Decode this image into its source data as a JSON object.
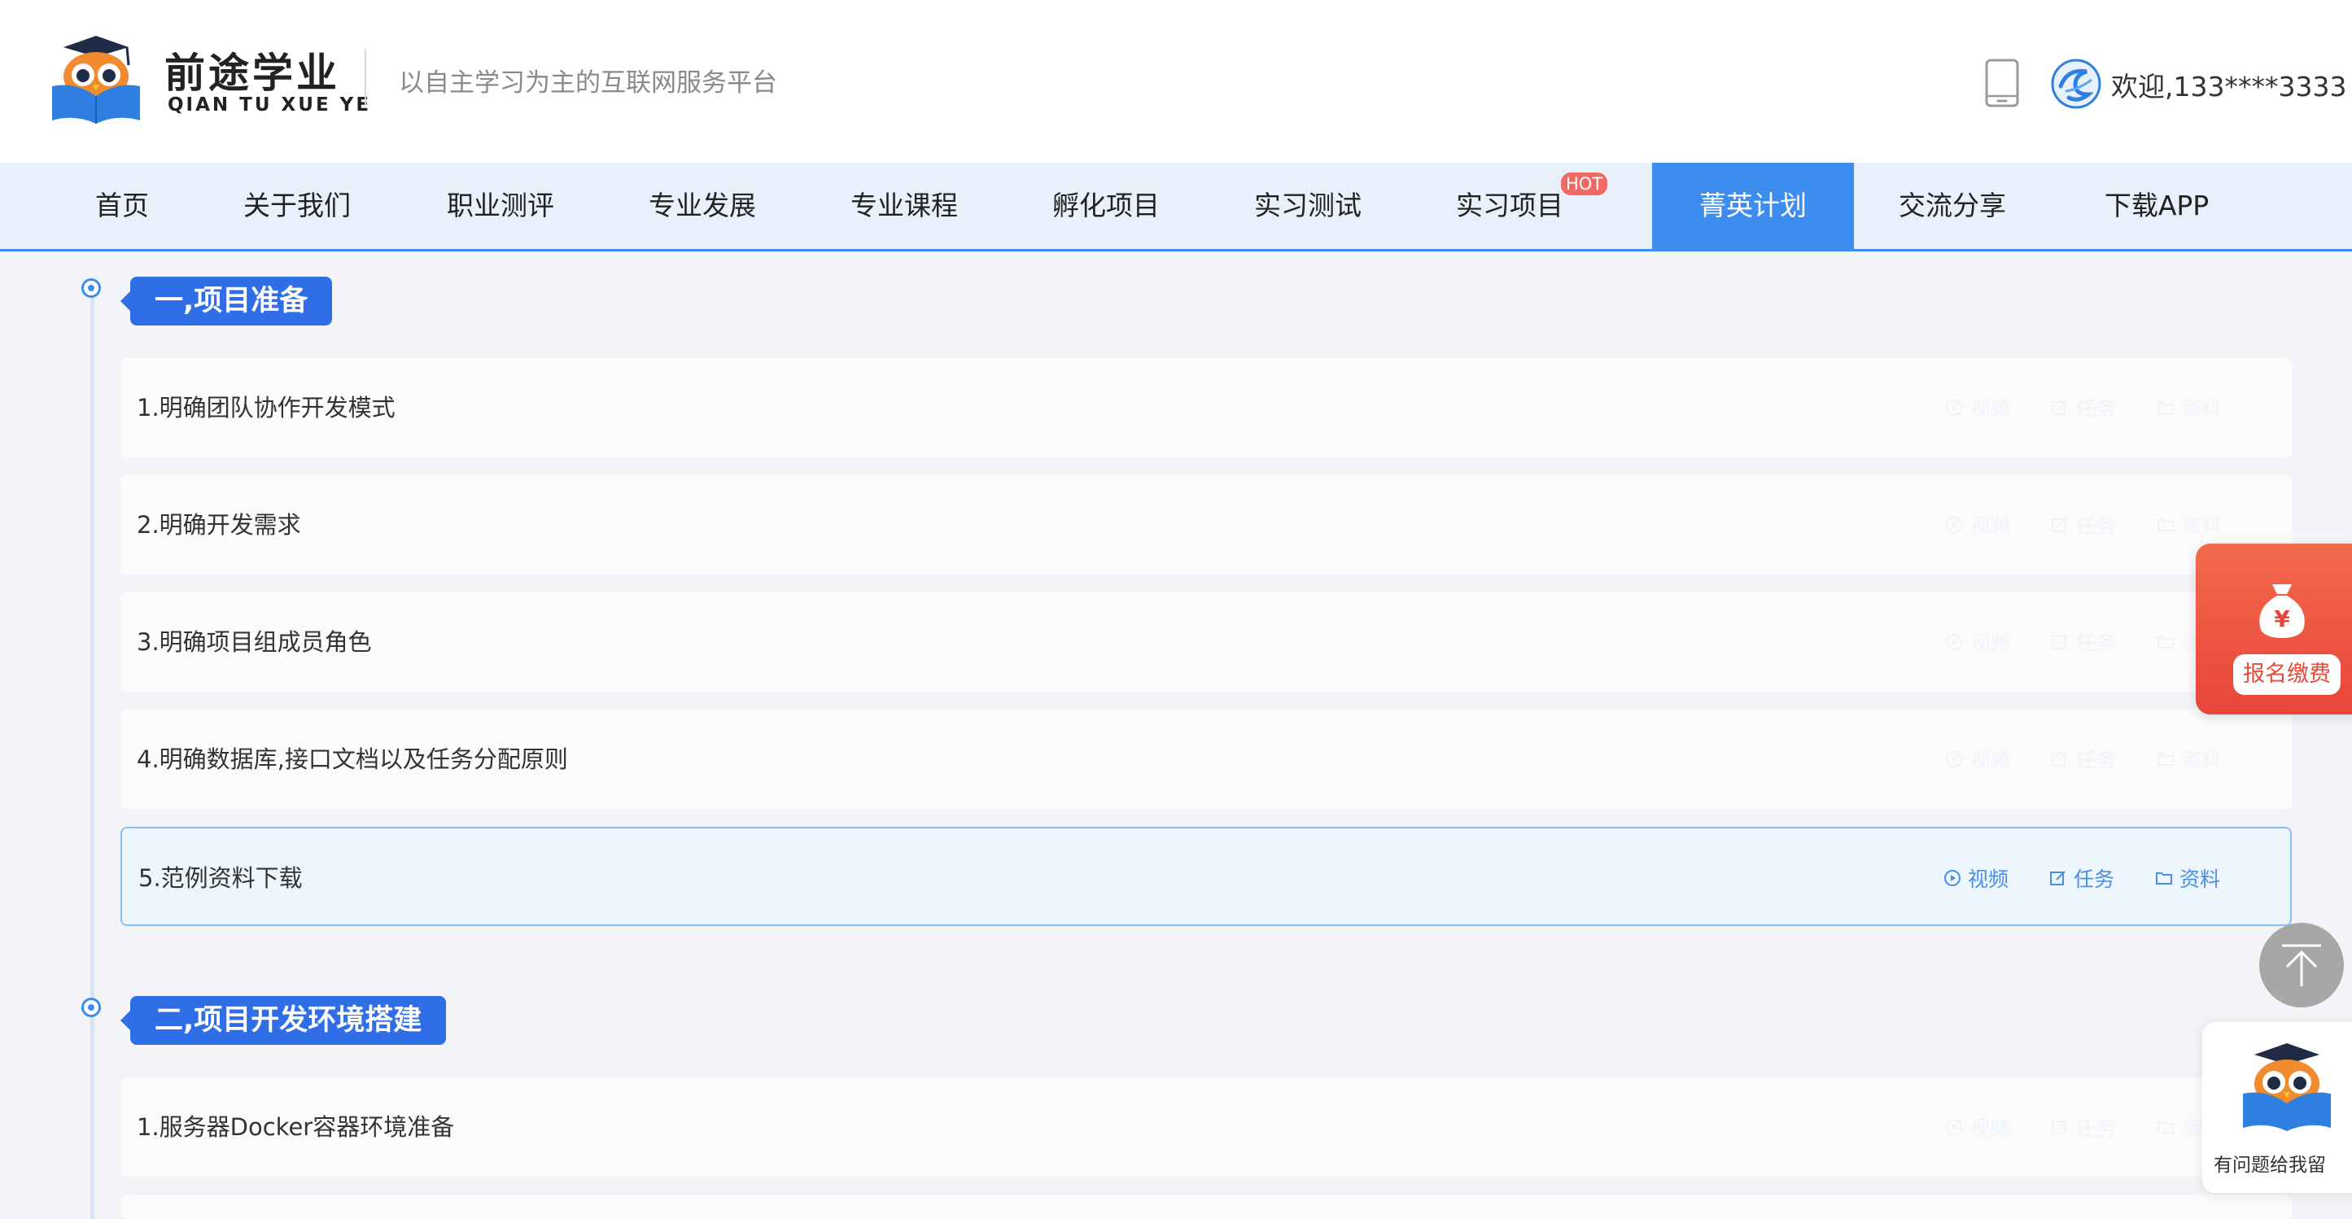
{
  "header": {
    "brand_cn": "前途学业",
    "brand_en": "QIAN TU XUE YE",
    "slogan": "以自主学习为主的互联网服务平台",
    "welcome": "欢迎,133****3333"
  },
  "nav": {
    "items": [
      {
        "label": "首页"
      },
      {
        "label": "关于我们"
      },
      {
        "label": "职业测评"
      },
      {
        "label": "专业发展"
      },
      {
        "label": "专业课程"
      },
      {
        "label": "孵化项目"
      },
      {
        "label": "实习测试"
      },
      {
        "label": "实习项目"
      },
      {
        "label": "菁英计划"
      },
      {
        "label": "交流分享"
      },
      {
        "label": "下载APP"
      }
    ],
    "active": "菁英计划",
    "hot_badge": "HOT"
  },
  "sections": [
    {
      "title": "一,项目准备",
      "items": [
        {
          "title": "1.明确团队协作开发模式"
        },
        {
          "title": "2.明确开发需求"
        },
        {
          "title": "3.明确项目组成员角色"
        },
        {
          "title": "4.明确数据库,接口文档以及任务分配原则"
        },
        {
          "title": "5.范例资料下载"
        }
      ]
    },
    {
      "title": "二,项目开发环境搭建",
      "items": [
        {
          "title": "1.服务器Docker容器环境准备"
        }
      ]
    }
  ],
  "actions": {
    "video": "视频",
    "task": "任务",
    "material": "资料"
  },
  "floating": {
    "pay_label": "报名缴费",
    "help_label": "有问题给我留"
  },
  "colors": {
    "primary": "#3d8cf0",
    "tag": "#2f6ee6",
    "hot": "#f06a63",
    "pay": "#e9453a",
    "page_bg": "#f2f4f8"
  }
}
